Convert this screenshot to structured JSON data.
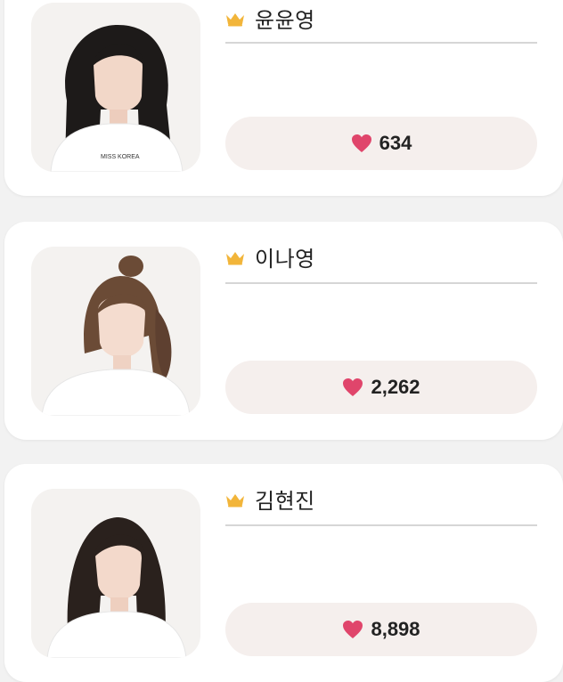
{
  "colors": {
    "page_bg": "#f2f2f2",
    "card_bg": "#ffffff",
    "vote_bg": "#f5efed",
    "crown": "#f2b53a",
    "heart": "#e0456b",
    "divider": "#d6d6d6"
  },
  "contestants": [
    {
      "name": "윤윤영",
      "votes": "634",
      "crown_icon": "crown-icon",
      "heart_icon": "heart-icon"
    },
    {
      "name": "이나영",
      "votes": "2,262",
      "crown_icon": "crown-icon",
      "heart_icon": "heart-icon"
    },
    {
      "name": "김현진",
      "votes": "8,898",
      "crown_icon": "crown-icon",
      "heart_icon": "heart-icon"
    }
  ]
}
